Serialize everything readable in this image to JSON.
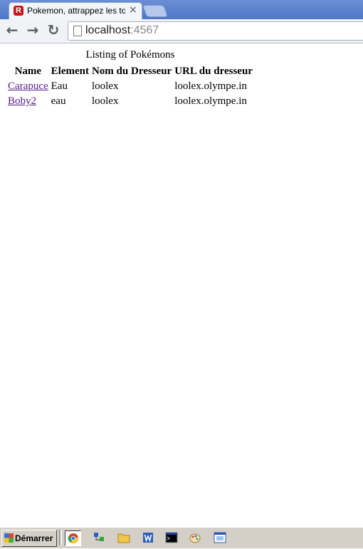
{
  "browser": {
    "tab": {
      "favicon_letter": "R",
      "title": "Pokemon, attrappez les tous",
      "close": "×"
    },
    "nav": {
      "back": "←",
      "forward": "→",
      "reload": "↻"
    },
    "url": {
      "host": "localhost",
      "port": ":4567"
    }
  },
  "page": {
    "caption": "Listing of Pokémons",
    "headers": [
      "Name",
      "Element",
      "Nom du Dresseur",
      "URL du dresseur"
    ],
    "rows": [
      {
        "name": "Carapuce",
        "element": "Eau",
        "trainer": "loolex",
        "trainer_url": "loolex.olympe.in"
      },
      {
        "name": "Boby2",
        "element": "eau",
        "trainer": "loolex",
        "trainer_url": "loolex.olympe.in"
      }
    ]
  },
  "taskbar": {
    "start_label": "Démarrer",
    "items": [
      "chrome-icon",
      "network-icon",
      "folder-icon",
      "word-icon",
      "terminal-icon",
      "paint-icon",
      "window-icon"
    ]
  }
}
